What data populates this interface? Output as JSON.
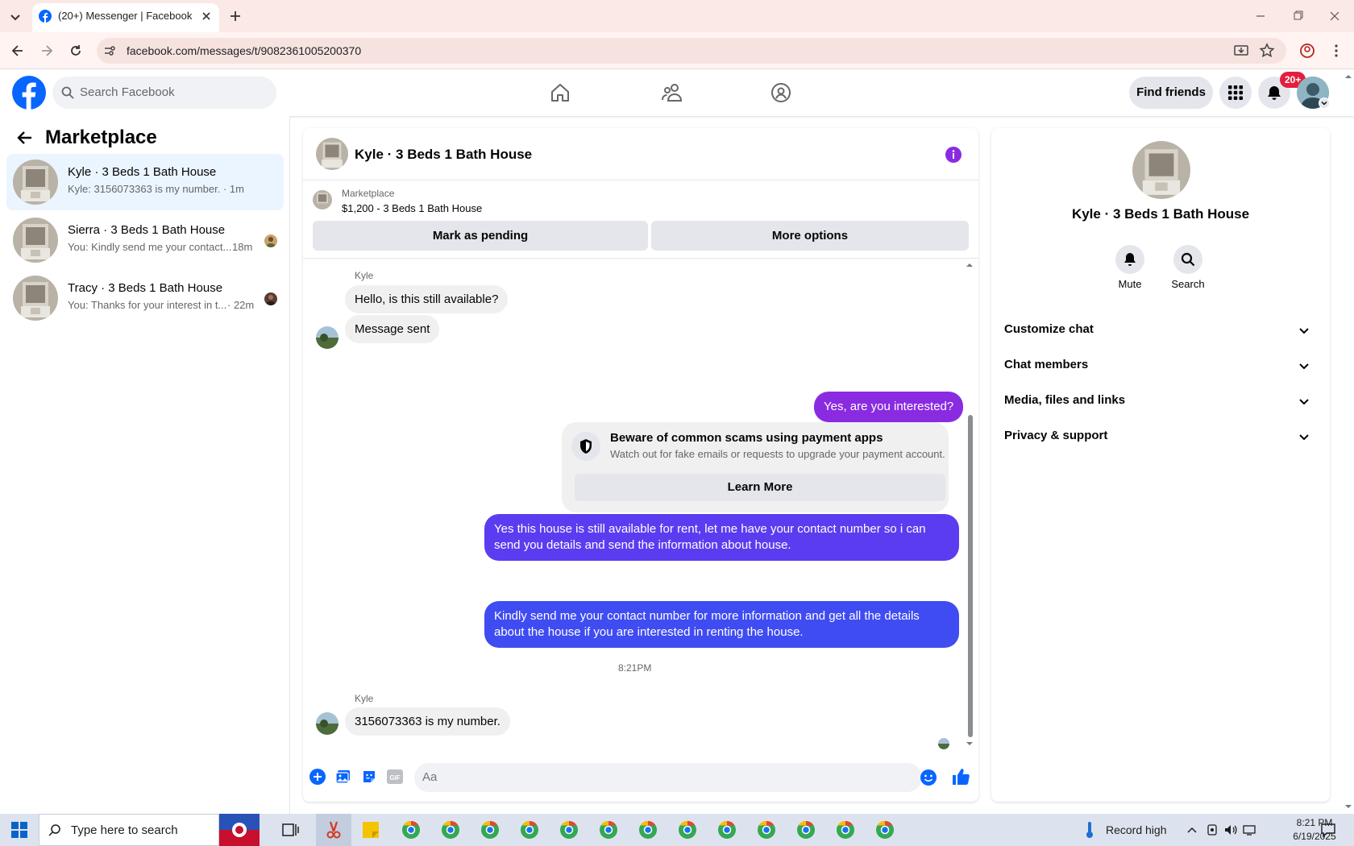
{
  "browser": {
    "tab_title": "(20+) Messenger | Facebook",
    "url": "facebook.com/messages/t/9082361005200370"
  },
  "header": {
    "search_placeholder": "Search Facebook",
    "find_friends": "Find friends",
    "notification_badge": "20+"
  },
  "sidebar": {
    "title": "Marketplace",
    "conversations": [
      {
        "name": "Kyle · 3 Beds 1 Bath House",
        "preview": "Kyle: 3156073363 is my number. · 1m",
        "time": ""
      },
      {
        "name": "Sierra · 3 Beds 1 Bath House",
        "preview": "You: Kindly send me your contact...",
        "time": "18m"
      },
      {
        "name": "Tracy · 3 Beds 1 Bath House",
        "preview": "You: Thanks for your interest in t...",
        "time": "· 22m"
      }
    ]
  },
  "chat": {
    "title": "Kyle · 3 Beds 1 Bath House",
    "listing_label": "Marketplace",
    "listing_price": "$1,200 - 3 Beds 1 Bath House",
    "mark_pending": "Mark as pending",
    "more_options": "More options",
    "messages": {
      "sender1": "Kyle",
      "in1": "Hello, is this still available?",
      "in2": "Message sent",
      "out1": "Yes, are you interested?",
      "scam_title": "Beware of common scams using payment apps",
      "scam_sub": "Watch out for fake emails or requests to upgrade your payment account.",
      "learn_more": "Learn More",
      "out2": "Yes this house is still available for rent, let me have your contact number so i can send you details and send the information about house.",
      "out3": "Kindly send me your contact number for more information and get all the details about the house if you are interested in renting the house.",
      "time": "8:21PM",
      "sender2": "Kyle",
      "in3": "3156073363 is my number."
    },
    "composer_placeholder": "Aa"
  },
  "details": {
    "name": "Kyle · 3 Beds 1 Bath House",
    "mute": "Mute",
    "search": "Search",
    "sections": [
      "Customize chat",
      "Chat members",
      "Media, files and links",
      "Privacy & support"
    ]
  },
  "taskbar": {
    "search_text": "Type here to search",
    "weather": "Record high",
    "time": "8:21 PM",
    "date": "6/19/2025"
  },
  "colors": {
    "fb_blue": "#0866ff",
    "messenger_purple": "#8a2be2",
    "outgoing_blue": "#3b4ef0"
  }
}
